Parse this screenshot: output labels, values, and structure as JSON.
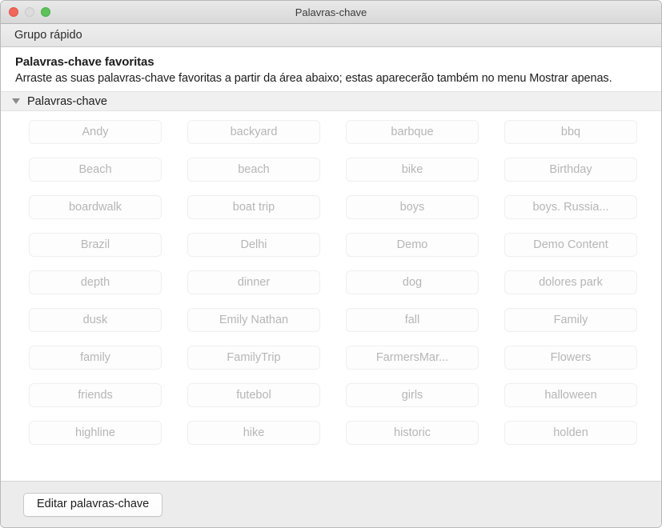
{
  "window": {
    "title": "Palavras-chave",
    "traffic_lights": [
      {
        "name": "close",
        "color": "#f0675c"
      },
      {
        "name": "minimize",
        "color": "#dcdcdc"
      },
      {
        "name": "zoom",
        "color": "#5ec25a"
      }
    ]
  },
  "toolbar": {
    "label": "Grupo rápido"
  },
  "header": {
    "title": "Palavras-chave favoritas",
    "description": "Arraste as suas palavras-chave favoritas a partir da área abaixo; estas aparecerão também no menu Mostrar apenas."
  },
  "section": {
    "label": "Palavras-chave",
    "disclosure_icon": "triangle-down-icon",
    "expanded": true
  },
  "keywords": [
    "Andy",
    "backyard",
    "barbque",
    "bbq",
    "Beach",
    "beach",
    "bike",
    "Birthday",
    "boardwalk",
    "boat trip",
    "boys",
    "boys. Russia...",
    "Brazil",
    "Delhi",
    "Demo",
    "Demo Content",
    "depth",
    "dinner",
    "dog",
    "dolores park",
    "dusk",
    "Emily Nathan",
    "fall",
    "Family",
    "family",
    "FamilyTrip",
    "FarmersMar...",
    "Flowers",
    "friends",
    "futebol",
    "girls",
    "halloween",
    "highline",
    "hike",
    "historic",
    "holden"
  ],
  "footer": {
    "edit_button_label": "Editar palavras-chave"
  },
  "colors": {
    "chip_text": "#b6b6b6",
    "chip_border": "#efefef",
    "chip_fill": "#fdfdfd",
    "window_chrome": "#e4e4e4",
    "footer_bg": "#ececec"
  }
}
